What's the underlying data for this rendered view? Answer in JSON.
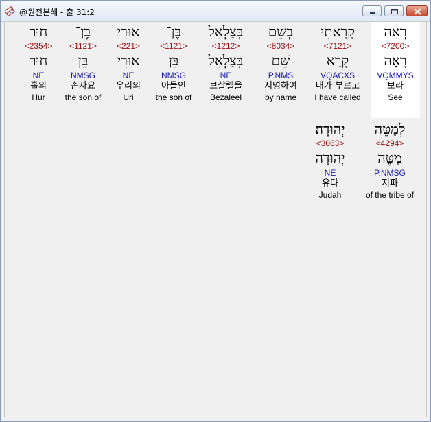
{
  "window": {
    "title": "@원전본해 - 출 31:2",
    "icon": "bible-app-icon",
    "controls": [
      "minimize-icon",
      "maximize-icon",
      "close-icon"
    ]
  },
  "colors": {
    "strong_number": "#a01010",
    "parsing": "#1717b0",
    "highlight_background": "#ffffff"
  },
  "words": [
    {
      "hebrew": "רְאֵה",
      "strong": "<7200>",
      "lemma": "רָאָה",
      "parsing": "VQMMYS",
      "korean": "보라",
      "english": "See",
      "highlighted": true
    },
    {
      "hebrew": "קָרָאתִי",
      "strong": "<7121>",
      "lemma": "קָרָא",
      "parsing": "VQACXS",
      "korean": "내가-부르고",
      "english": "I have called",
      "highlighted": false
    },
    {
      "hebrew": "בְשֵׁם",
      "strong": "<8034>",
      "lemma": "שֵׁם",
      "parsing": "P.NMS",
      "korean": "지명하여",
      "english": "by name",
      "highlighted": false
    },
    {
      "hebrew": "בְּצַלְאֵל",
      "strong": "<1212>",
      "lemma": "בְּצַלְאֵל",
      "parsing": "NE",
      "korean": "브살렐을",
      "english": "Bezaleel",
      "highlighted": false
    },
    {
      "hebrew": "בֶּן־",
      "strong": "<1121>",
      "lemma": "בֵּן",
      "parsing": "NMSG",
      "korean": "아들인",
      "english": "the son of",
      "highlighted": false
    },
    {
      "hebrew": "אוּרִי",
      "strong": "<221>",
      "lemma": "אוּרִי",
      "parsing": "NE",
      "korean": "우리의",
      "english": "Uri",
      "highlighted": false
    },
    {
      "hebrew": "בֶן־",
      "strong": "<1121>",
      "lemma": "בֵּן",
      "parsing": "NMSG",
      "korean": "손자요",
      "english": "the son of",
      "highlighted": false
    },
    {
      "hebrew": "חוּר",
      "strong": "<2354>",
      "lemma": "חוּר",
      "parsing": "NE",
      "korean": "홀의",
      "english": "Hur",
      "highlighted": false
    },
    {
      "hebrew": "לְמַטֵּה",
      "strong": "<4294>",
      "lemma": "מַטֶּה",
      "parsing": "P.NMSG",
      "korean": "지파",
      "english": "of the tribe of",
      "highlighted": false
    },
    {
      "hebrew": "יְהוּדָה׃",
      "strong": "<3063>",
      "lemma": "יְהוּדָה",
      "parsing": "NE",
      "korean": "유다",
      "english": "Judah",
      "highlighted": false
    }
  ]
}
